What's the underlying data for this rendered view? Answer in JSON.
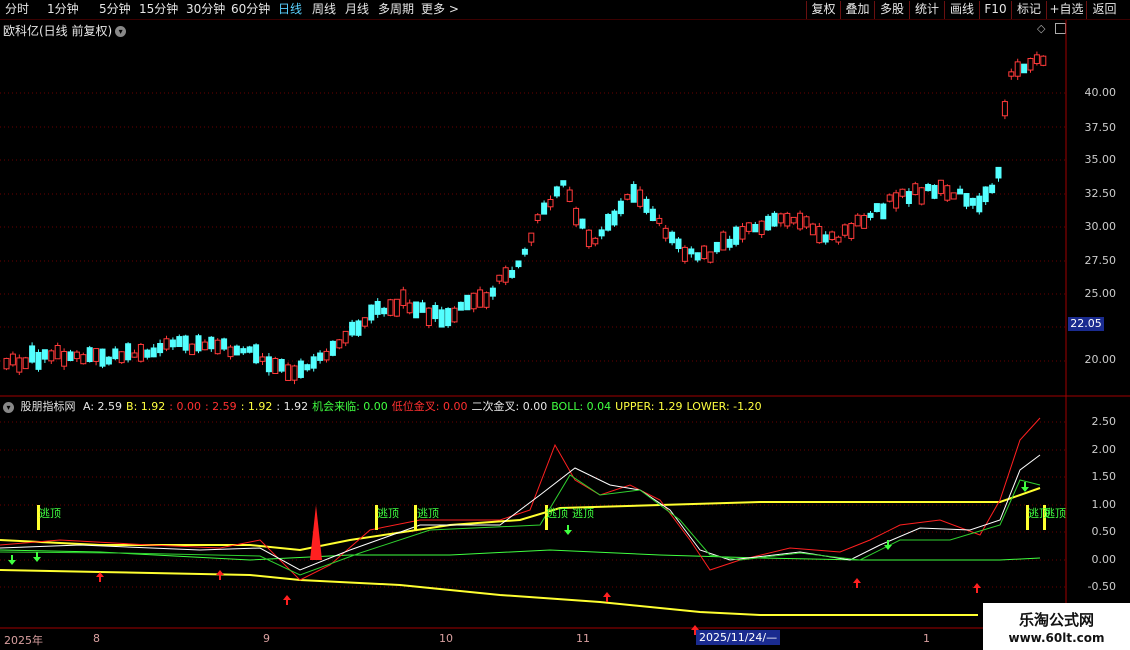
{
  "toolbar": {
    "periods": [
      "分时",
      "1分钟",
      "5分钟",
      "15分钟",
      "30分钟",
      "60分钟",
      "日线",
      "周线",
      "月线",
      "多周期",
      "更多 >"
    ],
    "active": "日线",
    "right": [
      "复权",
      "叠加",
      "多股",
      "统计",
      "画线",
      "F10",
      "标记",
      "+自选",
      "返回"
    ]
  },
  "main_panel": {
    "title": "欧科亿(日线 前复权)",
    "price_ticks": [
      "40.00",
      "37.50",
      "35.00",
      "32.50",
      "30.00",
      "27.50",
      "25.00",
      "20.00"
    ],
    "current_price": "22.05"
  },
  "indicator_panel": {
    "name": "股朋指标网",
    "values": [
      {
        "text": "A: 2.59",
        "color": "#e6e6e6"
      },
      {
        "text": "B: 1.92",
        "color": "#ffff40"
      },
      {
        "text": ": 0.00",
        "color": "#ff3030"
      },
      {
        "text": ": 2.59",
        "color": "#ff3030"
      },
      {
        "text": ": 1.92",
        "color": "#ffff40"
      },
      {
        "text": ": 1.92",
        "color": "#e6e6e6"
      },
      {
        "text": "机会来临: 0.00",
        "color": "#40ff40"
      },
      {
        "text": "低位金叉: 0.00",
        "color": "#ff3030"
      },
      {
        "text": "二次金叉: 0.00",
        "color": "#e6e6e6"
      },
      {
        "text": "BOLL: 0.04",
        "color": "#40ff40"
      },
      {
        "text": "UPPER: 1.29",
        "color": "#ffff40"
      },
      {
        "text": "LOWER: -1.20",
        "color": "#ffff40"
      }
    ],
    "ticks": [
      "2.50",
      "2.00",
      "1.50",
      "1.00",
      "0.50",
      "0.00",
      "-0.50"
    ],
    "signal_label": "逃顶"
  },
  "x_axis": {
    "labels": [
      "2025年",
      "8",
      "9",
      "10",
      "11",
      "1"
    ],
    "cursor_date": "2025/11/24/—"
  },
  "watermark": {
    "line1": "乐淘公式网",
    "line2": "www.60lt.com"
  }
}
